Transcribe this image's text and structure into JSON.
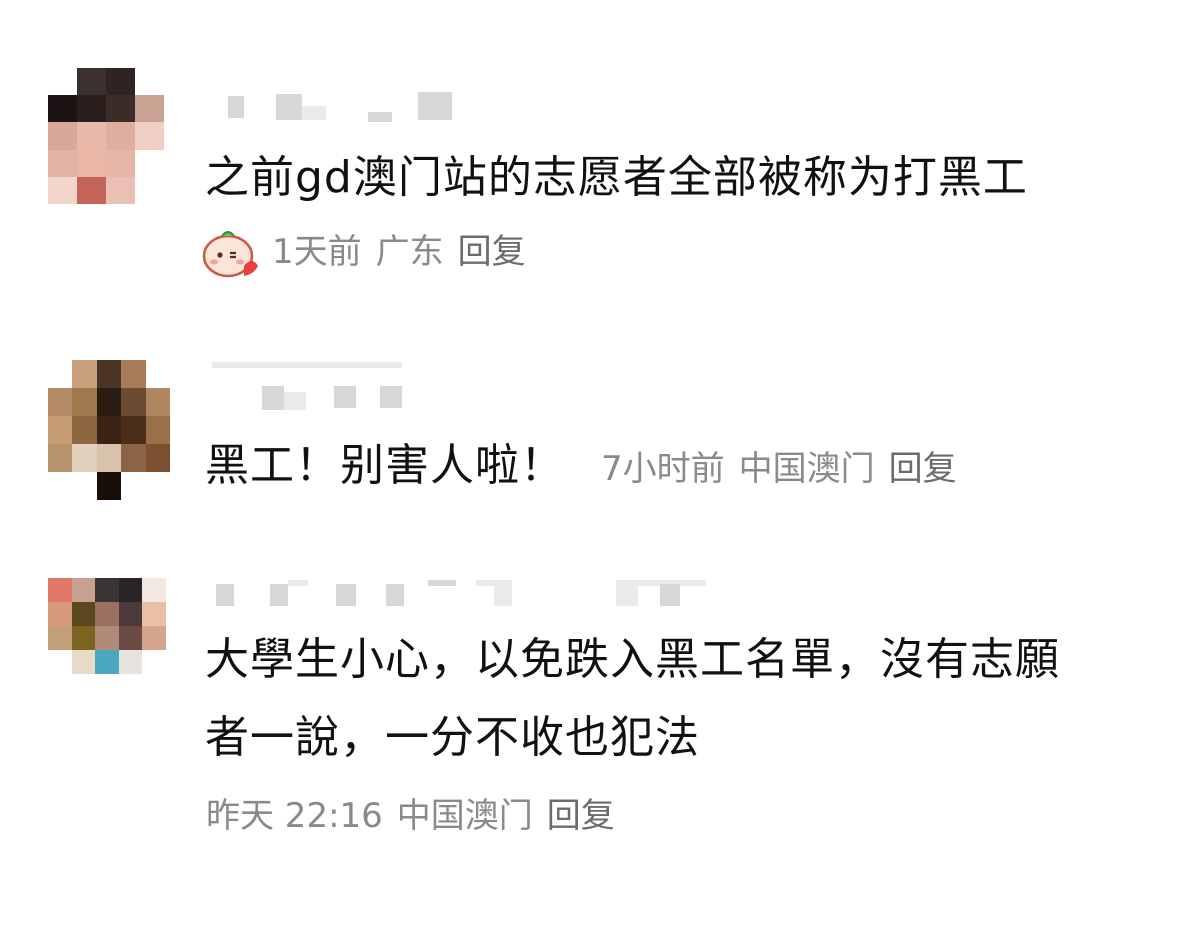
{
  "comments": [
    {
      "text": "之前gd澳门站的志愿者全部被称为打黑工",
      "time": "1天前",
      "location": "广东",
      "reply_label": "回复",
      "sticker_icon": "blushing-face-sticker-icon"
    },
    {
      "text": "黑工！别害人啦！",
      "time": "7小时前",
      "location": "中国澳门",
      "reply_label": "回复"
    },
    {
      "text_line1": "大學生小心，以免跌入黑工名單，沒有志願",
      "text_line2": "者一說，一分不收也犯法",
      "time": "昨天 22:16",
      "location": "中国澳门",
      "reply_label": "回复"
    }
  ]
}
